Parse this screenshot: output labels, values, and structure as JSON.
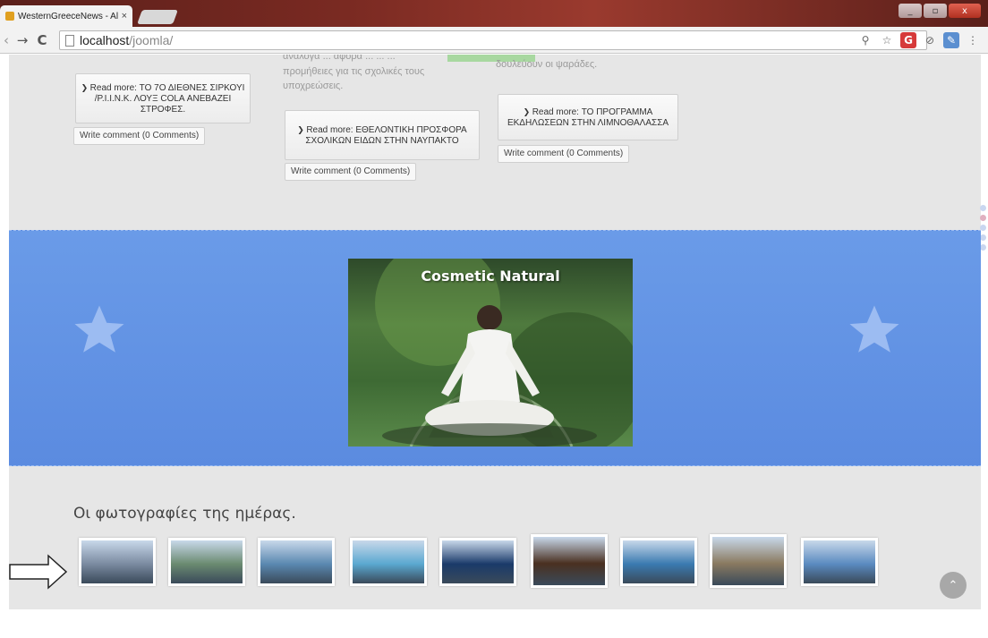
{
  "browser": {
    "tab_title": "WesternGreeceNews - Al",
    "tab_close": "×",
    "url_host": "localhost",
    "url_path": "/joomla/",
    "window_buttons": [
      "_",
      "▫",
      "x"
    ]
  },
  "articles": {
    "faint_text_1": "προμήθειες για τις σχολικές τους",
    "faint_text_2": "υποχρεώσεις.",
    "faint_text_3": "δουλεύουν οι ψαράδες.",
    "faint_text_4": "ανάλογα ... αφορα ... ... ...",
    "read_more": [
      {
        "label": "Read more: ΤΟ 7Ο ΔΙΕΘΝΕΣ ΣΙΡΚΟΥΙ /Ρ.Ι.Ι.Ν.Κ. ΛΟΥΞ COLA ΑΝΕΒΑΖΕΙ ΣΤΡΟΦΕΣ."
      },
      {
        "label": "Read more: ΕΘΕΛΟΝΤΙΚΗ ΠΡΟΣΦΟΡΑ ΣΧΟΛΙΚΩΝ ΕΙΔΩΝ ΣΤΗΝ ΝΑΥΠΑΚΤΟ"
      },
      {
        "label": "Read more: ΤΟ ΠΡΟΓΡΑΜΜΑ ΕΚΔΗΛΩΣΕΩΝ ΣΤΗΝ ΛΙΜΝΟΘΑΛΑΣΣΑ"
      }
    ],
    "write_comment": "Write comment (0 Comments)"
  },
  "slider": {
    "title": "Cosmetic Natural",
    "icons": [
      "star-icon",
      "star-icon"
    ]
  },
  "photos": {
    "title": "Οι φωτογραφίες της ημέρας.",
    "count": 9,
    "colors": [
      "#7a8aa0",
      "#6a8a70",
      "#5a88b0",
      "#5aa8d0",
      "#1a3a6a",
      "#4a3020",
      "#3a7ab0",
      "#8a7a60",
      "#5a8ac0"
    ]
  },
  "colors": {
    "band": "#5b8be0",
    "page_bg": "#e6e6e6"
  }
}
